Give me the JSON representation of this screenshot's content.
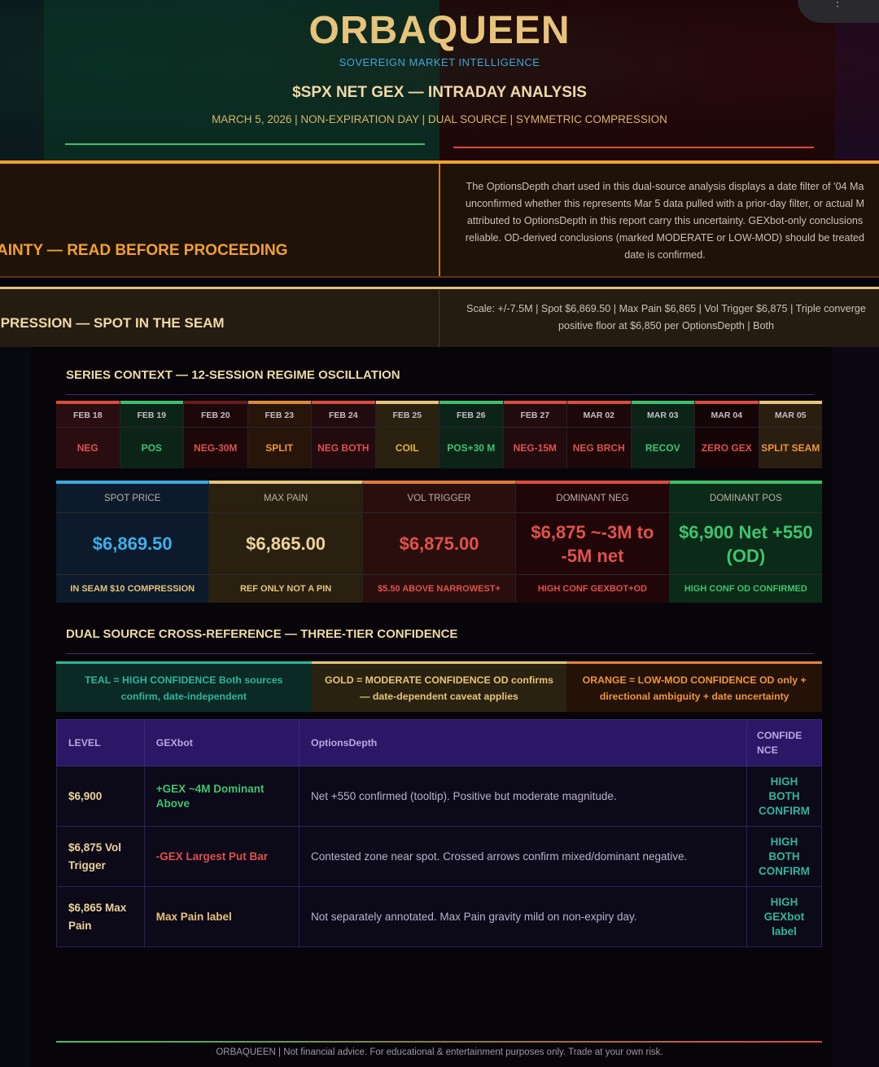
{
  "header": {
    "brand": "ORBAQUEEN",
    "subtitle": "SOVEREIGN MARKET INTELLIGENCE",
    "title": "$SPX NET GEX — INTRADAY ANALYSIS",
    "meta": "MARCH 5, 2026 | NON-EXPIRATION DAY | DUAL SOURCE | SYMMETRIC COMPRESSION"
  },
  "warning": {
    "title": "AINTY — READ BEFORE PROCEEDING",
    "lines": [
      "The OptionsDepth chart used in this dual-source analysis displays a date filter of '04 Ma",
      "unconfirmed whether this represents Mar 5 data pulled with a prior-day filter, or actual M",
      "attributed to OptionsDepth in this report carry this uncertainty. GEXbot-only conclusions",
      "reliable. OD-derived conclusions (marked MODERATE or LOW-MOD) should be treated",
      "date is confirmed."
    ]
  },
  "compression": {
    "title": "IPRESSION — SPOT IN THE SEAM",
    "lines": [
      "Scale: +/-7.5M | Spot $6,869.50 | Max Pain $6,865 | Vol Trigger $6,875 | Triple converge",
      "positive floor at $6,850 per OptionsDepth | Both"
    ]
  },
  "series": {
    "title": "SERIES CONTEXT — 12-SESSION REGIME OSCILLATION",
    "sessions": [
      {
        "date": "FEB 18",
        "value": "NEG",
        "accent": "#d94c3e",
        "bg": "#2a0d10",
        "color": "#e0524a"
      },
      {
        "date": "FEB 19",
        "value": "POS",
        "accent": "#3fbf6a",
        "bg": "#0c2418",
        "color": "#3fc46e"
      },
      {
        "date": "FEB 20",
        "value": "NEG-30M",
        "accent": "#6a1a1a",
        "bg": "#1c0809",
        "color": "#e0524a"
      },
      {
        "date": "FEB 23",
        "value": "SPLIT",
        "accent": "#e0873a",
        "bg": "#261508",
        "color": "#f0953c"
      },
      {
        "date": "FEB 24",
        "value": "NEG BOTH",
        "accent": "#d94c3e",
        "bg": "#220b0e",
        "color": "#e0524a"
      },
      {
        "date": "FEB 25",
        "value": "COIL",
        "accent": "#e7c47a",
        "bg": "#2a210f",
        "color": "#e7b44a"
      },
      {
        "date": "FEB 26",
        "value": "POS+30 M",
        "accent": "#3fbf6a",
        "bg": "#0c2418",
        "color": "#3fc46e"
      },
      {
        "date": "FEB 27",
        "value": "NEG-15M",
        "accent": "#d94c3e",
        "bg": "#220b0e",
        "color": "#e0524a"
      },
      {
        "date": "MAR 02",
        "value": "NEG BRCH",
        "accent": "#d94c3e",
        "bg": "#1c0809",
        "color": "#e0524a"
      },
      {
        "date": "MAR 03",
        "value": "RECOV",
        "accent": "#3fbf6a",
        "bg": "#0c2418",
        "color": "#3fc46e"
      },
      {
        "date": "MAR 04",
        "value": "ZERO GEX",
        "accent": "#d94c3e",
        "bg": "#140406",
        "color": "#e0524a"
      },
      {
        "date": "MAR 05",
        "value": "SPLIT SEAM",
        "accent": "#e7c47a",
        "bg": "#2a1e10",
        "color": "#f0953c"
      }
    ]
  },
  "metrics": [
    {
      "label": "SPOT PRICE",
      "value": "$6,869.50",
      "note": "IN SEAM $10 COMPRESSION",
      "accent": "#3ba8e0",
      "bg": "#0c1a2c",
      "color": "#3fb0ea",
      "note_color": "#e7c47a"
    },
    {
      "label": "MAX PAIN",
      "value": "$6,865.00",
      "note": "REF ONLY NOT A PIN",
      "accent": "#e7c47a",
      "bg": "#2a2010",
      "color": "#ecd39a",
      "note_color": "#e7c47a"
    },
    {
      "label": "VOL TRIGGER",
      "value": "$6,875.00",
      "note": "$5.50 ABOVE NARROWEST+",
      "accent": "#e07a3a",
      "bg": "#2a0e0e",
      "color": "#e0524a",
      "note_color": "#e0524a"
    },
    {
      "label": "DOMINANT NEG",
      "value": "$6,875 ~-3M to -5M net",
      "note": "HIGH CONF GEXBOT+OD",
      "accent": "#d94c3e",
      "bg": "#200609",
      "color": "#e0524a",
      "note_color": "#e0524a"
    },
    {
      "label": "DOMINANT POS",
      "value": "$6,900 Net +550 (OD)",
      "note": "HIGH CONF OD CONFIRMED",
      "accent": "#3fbf6a",
      "bg": "#0c2a18",
      "color": "#3fc46e",
      "note_color": "#3fc46e"
    }
  ],
  "dual": {
    "title": "DUAL SOURCE CROSS-REFERENCE — THREE-TIER CONFIDENCE",
    "legend": [
      {
        "text": "TEAL = HIGH CONFIDENCE Both sources confirm, date-independent",
        "accent": "#2fb59b",
        "bg": "#0b2a26",
        "color": "#2fb59b"
      },
      {
        "text": "GOLD = MODERATE CONFIDENCE OD confirms — date-dependent caveat applies",
        "accent": "#e7c47a",
        "bg": "#2a2210",
        "color": "#e7c47a"
      },
      {
        "text": "ORANGE = LOW-MOD CONFIDENCE OD only + directional ambiguity + date uncertainty",
        "accent": "#e0873a",
        "bg": "#241208",
        "color": "#f0953c"
      }
    ],
    "table": {
      "headers": [
        "LEVEL",
        "GEXbot",
        "OptionsDepth",
        "CONFIDE NCE"
      ],
      "rows": [
        {
          "level": "$6,900",
          "gex": "+GEX ~4M Dominant Above",
          "gex_color": "#3fc46e",
          "od": "Net +550 confirmed (tooltip). Positive but moderate magnitude.",
          "conf": "HIGH BOTH CONFIRM"
        },
        {
          "level": "$6,875 Vol Trigger",
          "gex": "-GEX Largest Put Bar",
          "gex_color": "#e0524a",
          "od": "Contested zone near spot. Crossed arrows confirm mixed/dominant negative.",
          "conf": "HIGH BOTH CONFIRM"
        },
        {
          "level": "$6,865 Max Pain",
          "gex": "Max Pain label",
          "gex_color": "#e7c47a",
          "od": "Not separately annotated. Max Pain gravity mild on non-expiry day.",
          "conf": "HIGH GEXbot label"
        }
      ]
    }
  },
  "footer": {
    "text": "ORBAQUEEN  |  Not financial advice. For educational & entertainment purposes only. Trade at your own risk."
  }
}
